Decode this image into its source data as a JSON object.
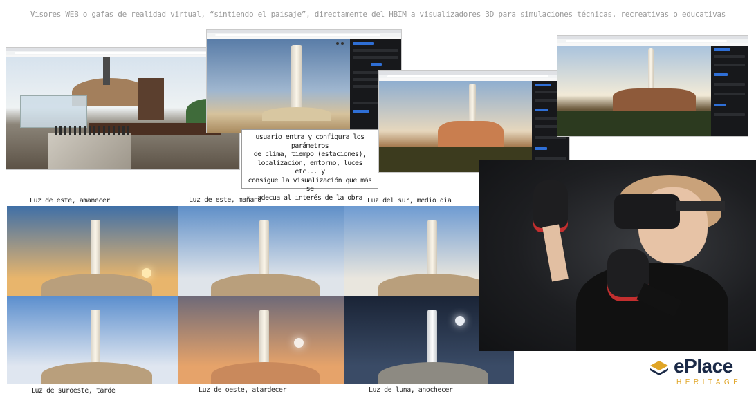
{
  "headline": "Visores WEB o gafas de realidad virtual, “sintiendo el paisaje”, directamente del HBIM a visualizadores 3D para simulaciones técnicas, recreativas o educativas",
  "note": {
    "lines": [
      "usuario entra y configura los parámetros",
      "de clima, tiempo (estaciones),",
      "localización, entorno, luces etc... y",
      "consigue la visualización que más se",
      "adecua al interés de la obra"
    ]
  },
  "thumbnails": [
    {
      "caption": "Luz de este, amanecer",
      "sky_top": "#3f6fa7",
      "sky_bottom": "#e8b56c",
      "sun": "#ffe9b0"
    },
    {
      "caption": "Luz de este, mañana",
      "sky_top": "#5f8fc8",
      "sky_bottom": "#dfe4ea",
      "sun": ""
    },
    {
      "caption": "Luz del sur, medio dia",
      "sky_top": "#6e9bd2",
      "sky_bottom": "#e9e6de",
      "sun": ""
    },
    {
      "caption": "Luz de suroeste, tarde",
      "sky_top": "#5c8fce",
      "sky_bottom": "#dfe6f0",
      "sun": ""
    },
    {
      "caption": "Luz de oeste, atardecer",
      "sky_top": "#6f6a78",
      "sky_bottom": "#e6a36a",
      "sun": "#f5eee8"
    },
    {
      "caption": "Luz de luna, anochecer",
      "sky_top": "#1a2436",
      "sky_bottom": "#3a4b66",
      "sun": "#e8ecf2"
    }
  ],
  "logo": {
    "name": "ePlace",
    "tagline": "HERITAGE",
    "primary_color": "#1b2a47",
    "accent_color": "#e0a526"
  }
}
